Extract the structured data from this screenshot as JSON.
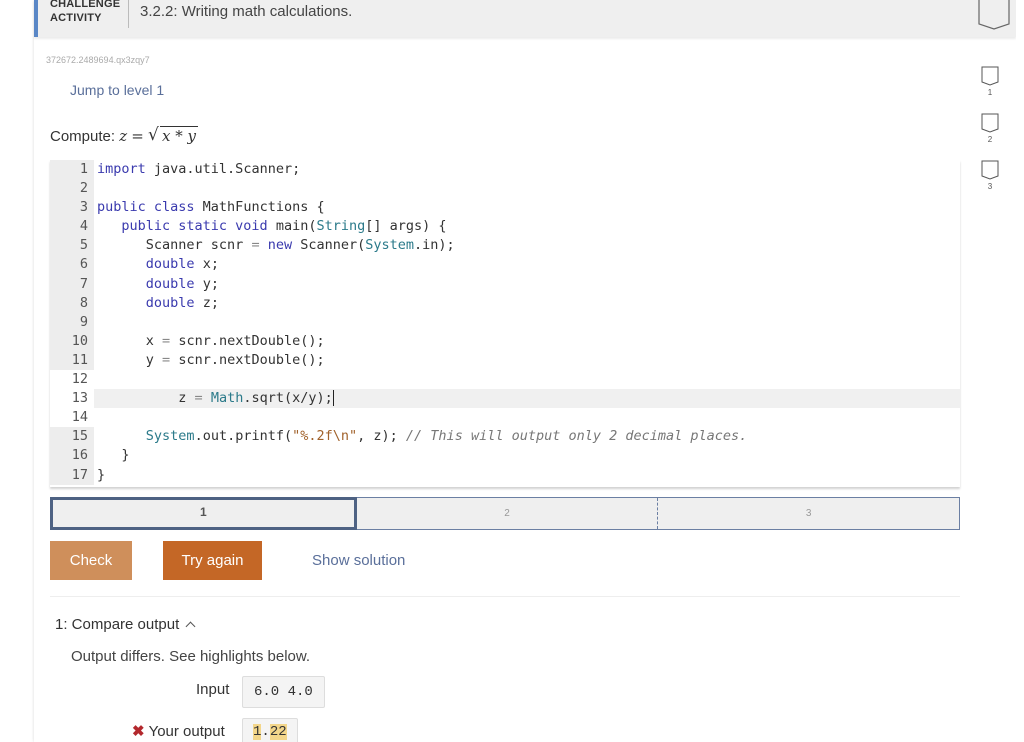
{
  "header": {
    "label_line1": "CHALLENGE",
    "label_line2": "ACTIVITY",
    "title": "3.2.2: Writing math calculations."
  },
  "activity_id": "372672.2489694.qx3zqy7",
  "jump_link": "Jump to level 1",
  "compute": {
    "prefix": "Compute:",
    "lhs": "z",
    "eq": "=",
    "radicand": "x * y"
  },
  "editor": {
    "lines": [
      {
        "num": "1",
        "state": "locked"
      },
      {
        "num": "2",
        "state": "locked"
      },
      {
        "num": "3",
        "state": "locked"
      },
      {
        "num": "4",
        "state": "locked"
      },
      {
        "num": "5",
        "state": "locked"
      },
      {
        "num": "6",
        "state": "locked"
      },
      {
        "num": "7",
        "state": "locked"
      },
      {
        "num": "8",
        "state": "locked"
      },
      {
        "num": "9",
        "state": "locked"
      },
      {
        "num": "10",
        "state": "locked"
      },
      {
        "num": "11",
        "state": "locked"
      },
      {
        "num": "12",
        "state": "editable"
      },
      {
        "num": "13",
        "state": "editable-active"
      },
      {
        "num": "14",
        "state": "editable"
      },
      {
        "num": "15",
        "state": "locked"
      },
      {
        "num": "16",
        "state": "locked"
      },
      {
        "num": "17",
        "state": "locked"
      }
    ],
    "tokens": {
      "l1_kw": "import",
      "l1_rest": " java.util.Scanner;",
      "l3_kw": "public class",
      "l3_rest": " MathFunctions {",
      "l4_kw": "public static void",
      "l4_a": " main(",
      "l4_ty": "String",
      "l4_b": "[] args) {",
      "l5_a": "Scanner scnr ",
      "l5_op": "=",
      "l5_kw": " new",
      "l5_b": " Scanner(",
      "l5_ty": "System",
      "l5_c": ".in);",
      "l6_kw": "double",
      "l6_rest": " x;",
      "l7_kw": "double",
      "l7_rest": " y;",
      "l8_kw": "double",
      "l8_rest": " z;",
      "l10_a": "x ",
      "l10_op": "=",
      "l10_b": " scnr.nextDouble();",
      "l11_a": "y ",
      "l11_op": "=",
      "l11_b": " scnr.nextDouble();",
      "l13_a": "z ",
      "l13_op": "=",
      "l13_ty": " Math",
      "l13_b": ".sqrt(x/y);",
      "l15_ty": "System",
      "l15_a": ".out.printf(",
      "l15_st": "\"%.2f\\n\"",
      "l15_b": ", z); ",
      "l15_cm": "// This will output only 2 decimal places.",
      "l16": "}",
      "l17": "}"
    }
  },
  "levels": [
    {
      "label": "1",
      "current": true
    },
    {
      "label": "2",
      "current": false
    },
    {
      "label": "3",
      "current": false
    }
  ],
  "buttons": {
    "check": "Check",
    "try_again": "Try again",
    "show_solution": "Show solution"
  },
  "colors": {
    "accent": "#5a87c6",
    "check_button": "#cf8f5b",
    "try_again_button": "#c46726",
    "link": "#5a6f9a",
    "error": "#b3282d",
    "highlight": "#f3d68a"
  },
  "results": {
    "section_title": "1: Compare output",
    "message": "Output differs. See highlights below.",
    "input_label": "Input",
    "input_value": "6.0 4.0",
    "output_label": "Your output",
    "output_value_parts": [
      "1",
      ".",
      "22"
    ]
  },
  "progress_rail": [
    {
      "label": "1"
    },
    {
      "label": "2"
    },
    {
      "label": "3"
    }
  ]
}
